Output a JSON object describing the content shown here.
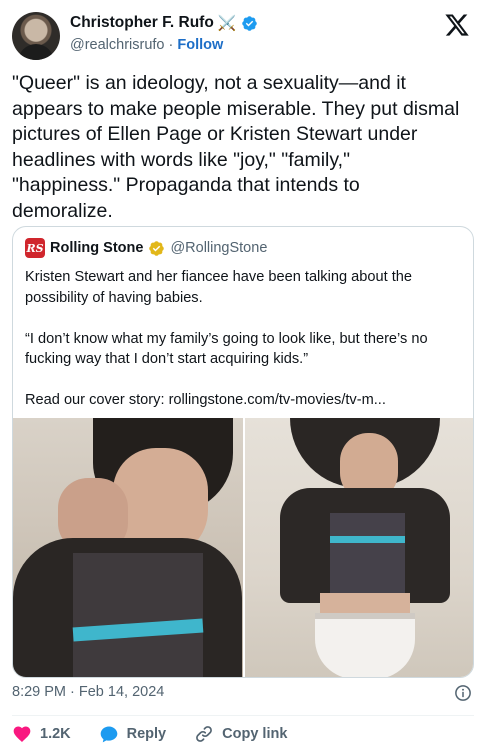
{
  "author": {
    "name": "Christopher F. Rufo",
    "emoji": "⚔️",
    "handle": "@realchrisrufo",
    "separator": "·",
    "follow_label": "Follow"
  },
  "tweet": {
    "text": "\"Queer\" is an ideology, not a sexuality—and it\nappears to make people miserable. They put dismal\npictures of Ellen Page or Kristen Stewart under\nheadlines with words like \"joy,\" \"family,\"\n\"happiness.\" Propaganda that intends to\ndemoralize."
  },
  "quote": {
    "logo_text": "RS",
    "name": "Rolling Stone",
    "handle": "@RollingStone",
    "text": "Kristen Stewart and her fiancee have been talking about the\npossibility of having babies.\n\n“I don’t know what my family’s going to look like, but there’s no\nfucking way that I don’t start acquiring kids.”\n\nRead our cover story: rollingstone.com/tv-movies/tv-m..."
  },
  "timestamp": "8:29 PM · Feb 14, 2024",
  "actions": {
    "like_count": "1.2K",
    "reply_label": "Reply",
    "copy_label": "Copy link"
  },
  "colors": {
    "like": "#f91880",
    "reply": "#1d9bf0",
    "verified": "#1d9bf0",
    "gold_verified": "#e2b719",
    "rolling_stone_red": "#d0262d"
  }
}
